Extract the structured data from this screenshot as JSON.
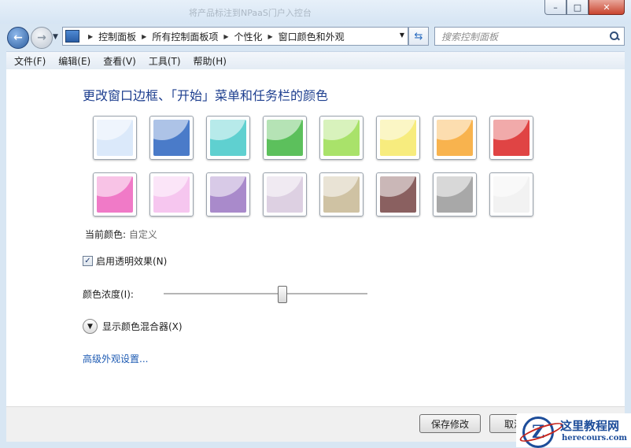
{
  "window": {
    "ghost_title": "将产品标注到NPaaS门户入控台",
    "min": "–",
    "max": "□",
    "close": "✕"
  },
  "nav": {
    "crumbs": [
      "控制面板",
      "所有控制面板项",
      "个性化",
      "窗口颜色和外观"
    ],
    "search_placeholder": "搜索控制面板"
  },
  "menu": [
    "文件(F)",
    "编辑(E)",
    "查看(V)",
    "工具(T)",
    "帮助(H)"
  ],
  "content": {
    "heading": "更改窗口边框、「开始」菜单和任务栏的颜色",
    "swatches": [
      {
        "name": "sky",
        "color": "#dbe9fa"
      },
      {
        "name": "twilight",
        "color": "#4a7bc9"
      },
      {
        "name": "sea",
        "color": "#5fd0d0"
      },
      {
        "name": "leaf",
        "color": "#5cc05c"
      },
      {
        "name": "lime",
        "color": "#a9e26a"
      },
      {
        "name": "pumpkin-light",
        "color": "#f7ec7e"
      },
      {
        "name": "pumpkin",
        "color": "#f8b34e"
      },
      {
        "name": "ruby",
        "color": "#e04444"
      },
      {
        "name": "fuchsia",
        "color": "#f07ac7"
      },
      {
        "name": "blush",
        "color": "#f6c6ef"
      },
      {
        "name": "violet",
        "color": "#a98acb"
      },
      {
        "name": "lavender",
        "color": "#ddd0e2"
      },
      {
        "name": "taupe",
        "color": "#cfc2a3"
      },
      {
        "name": "chocolate",
        "color": "#8a6060"
      },
      {
        "name": "slate",
        "color": "#a8a8a8"
      },
      {
        "name": "frost",
        "color": "#f2f2f2"
      }
    ],
    "current_label": "当前颜色:",
    "current_value": "自定义",
    "transparency_label": "启用透明效果(N)",
    "transparency_checked": "✓",
    "intensity_label": "颜色浓度(I):",
    "intensity_value": 0.58,
    "mixer_label": "显示颜色混合器(X)",
    "advanced_link": "高级外观设置..."
  },
  "footer": {
    "save": "保存修改",
    "cancel": "取消"
  },
  "watermark": {
    "logo_letter": "Z",
    "title": "这里教程网",
    "url": "herecours.com"
  }
}
